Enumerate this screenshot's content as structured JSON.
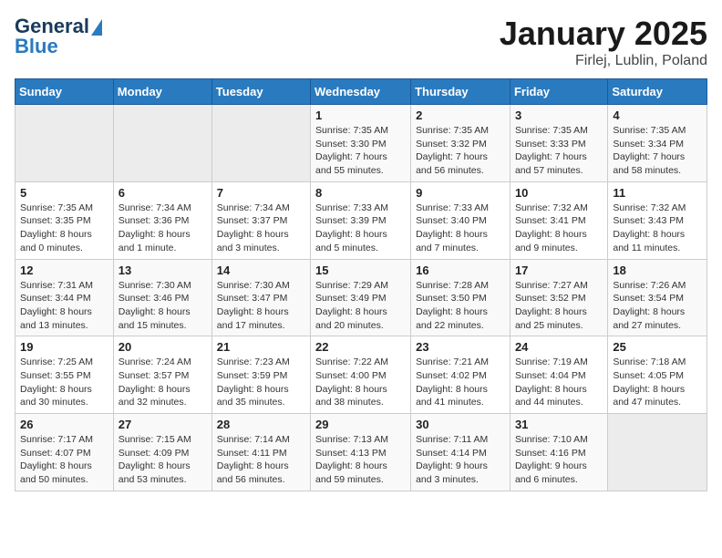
{
  "header": {
    "logo_line1": "General",
    "logo_line2": "Blue",
    "title": "January 2025",
    "subtitle": "Firlej, Lublin, Poland"
  },
  "weekdays": [
    "Sunday",
    "Monday",
    "Tuesday",
    "Wednesday",
    "Thursday",
    "Friday",
    "Saturday"
  ],
  "weeks": [
    [
      {
        "day": "",
        "sunrise": "",
        "sunset": "",
        "daylight": ""
      },
      {
        "day": "",
        "sunrise": "",
        "sunset": "",
        "daylight": ""
      },
      {
        "day": "",
        "sunrise": "",
        "sunset": "",
        "daylight": ""
      },
      {
        "day": "1",
        "sunrise": "Sunrise: 7:35 AM",
        "sunset": "Sunset: 3:30 PM",
        "daylight": "Daylight: 7 hours and 55 minutes."
      },
      {
        "day": "2",
        "sunrise": "Sunrise: 7:35 AM",
        "sunset": "Sunset: 3:32 PM",
        "daylight": "Daylight: 7 hours and 56 minutes."
      },
      {
        "day": "3",
        "sunrise": "Sunrise: 7:35 AM",
        "sunset": "Sunset: 3:33 PM",
        "daylight": "Daylight: 7 hours and 57 minutes."
      },
      {
        "day": "4",
        "sunrise": "Sunrise: 7:35 AM",
        "sunset": "Sunset: 3:34 PM",
        "daylight": "Daylight: 7 hours and 58 minutes."
      }
    ],
    [
      {
        "day": "5",
        "sunrise": "Sunrise: 7:35 AM",
        "sunset": "Sunset: 3:35 PM",
        "daylight": "Daylight: 8 hours and 0 minutes."
      },
      {
        "day": "6",
        "sunrise": "Sunrise: 7:34 AM",
        "sunset": "Sunset: 3:36 PM",
        "daylight": "Daylight: 8 hours and 1 minute."
      },
      {
        "day": "7",
        "sunrise": "Sunrise: 7:34 AM",
        "sunset": "Sunset: 3:37 PM",
        "daylight": "Daylight: 8 hours and 3 minutes."
      },
      {
        "day": "8",
        "sunrise": "Sunrise: 7:33 AM",
        "sunset": "Sunset: 3:39 PM",
        "daylight": "Daylight: 8 hours and 5 minutes."
      },
      {
        "day": "9",
        "sunrise": "Sunrise: 7:33 AM",
        "sunset": "Sunset: 3:40 PM",
        "daylight": "Daylight: 8 hours and 7 minutes."
      },
      {
        "day": "10",
        "sunrise": "Sunrise: 7:32 AM",
        "sunset": "Sunset: 3:41 PM",
        "daylight": "Daylight: 8 hours and 9 minutes."
      },
      {
        "day": "11",
        "sunrise": "Sunrise: 7:32 AM",
        "sunset": "Sunset: 3:43 PM",
        "daylight": "Daylight: 8 hours and 11 minutes."
      }
    ],
    [
      {
        "day": "12",
        "sunrise": "Sunrise: 7:31 AM",
        "sunset": "Sunset: 3:44 PM",
        "daylight": "Daylight: 8 hours and 13 minutes."
      },
      {
        "day": "13",
        "sunrise": "Sunrise: 7:30 AM",
        "sunset": "Sunset: 3:46 PM",
        "daylight": "Daylight: 8 hours and 15 minutes."
      },
      {
        "day": "14",
        "sunrise": "Sunrise: 7:30 AM",
        "sunset": "Sunset: 3:47 PM",
        "daylight": "Daylight: 8 hours and 17 minutes."
      },
      {
        "day": "15",
        "sunrise": "Sunrise: 7:29 AM",
        "sunset": "Sunset: 3:49 PM",
        "daylight": "Daylight: 8 hours and 20 minutes."
      },
      {
        "day": "16",
        "sunrise": "Sunrise: 7:28 AM",
        "sunset": "Sunset: 3:50 PM",
        "daylight": "Daylight: 8 hours and 22 minutes."
      },
      {
        "day": "17",
        "sunrise": "Sunrise: 7:27 AM",
        "sunset": "Sunset: 3:52 PM",
        "daylight": "Daylight: 8 hours and 25 minutes."
      },
      {
        "day": "18",
        "sunrise": "Sunrise: 7:26 AM",
        "sunset": "Sunset: 3:54 PM",
        "daylight": "Daylight: 8 hours and 27 minutes."
      }
    ],
    [
      {
        "day": "19",
        "sunrise": "Sunrise: 7:25 AM",
        "sunset": "Sunset: 3:55 PM",
        "daylight": "Daylight: 8 hours and 30 minutes."
      },
      {
        "day": "20",
        "sunrise": "Sunrise: 7:24 AM",
        "sunset": "Sunset: 3:57 PM",
        "daylight": "Daylight: 8 hours and 32 minutes."
      },
      {
        "day": "21",
        "sunrise": "Sunrise: 7:23 AM",
        "sunset": "Sunset: 3:59 PM",
        "daylight": "Daylight: 8 hours and 35 minutes."
      },
      {
        "day": "22",
        "sunrise": "Sunrise: 7:22 AM",
        "sunset": "Sunset: 4:00 PM",
        "daylight": "Daylight: 8 hours and 38 minutes."
      },
      {
        "day": "23",
        "sunrise": "Sunrise: 7:21 AM",
        "sunset": "Sunset: 4:02 PM",
        "daylight": "Daylight: 8 hours and 41 minutes."
      },
      {
        "day": "24",
        "sunrise": "Sunrise: 7:19 AM",
        "sunset": "Sunset: 4:04 PM",
        "daylight": "Daylight: 8 hours and 44 minutes."
      },
      {
        "day": "25",
        "sunrise": "Sunrise: 7:18 AM",
        "sunset": "Sunset: 4:05 PM",
        "daylight": "Daylight: 8 hours and 47 minutes."
      }
    ],
    [
      {
        "day": "26",
        "sunrise": "Sunrise: 7:17 AM",
        "sunset": "Sunset: 4:07 PM",
        "daylight": "Daylight: 8 hours and 50 minutes."
      },
      {
        "day": "27",
        "sunrise": "Sunrise: 7:15 AM",
        "sunset": "Sunset: 4:09 PM",
        "daylight": "Daylight: 8 hours and 53 minutes."
      },
      {
        "day": "28",
        "sunrise": "Sunrise: 7:14 AM",
        "sunset": "Sunset: 4:11 PM",
        "daylight": "Daylight: 8 hours and 56 minutes."
      },
      {
        "day": "29",
        "sunrise": "Sunrise: 7:13 AM",
        "sunset": "Sunset: 4:13 PM",
        "daylight": "Daylight: 8 hours and 59 minutes."
      },
      {
        "day": "30",
        "sunrise": "Sunrise: 7:11 AM",
        "sunset": "Sunset: 4:14 PM",
        "daylight": "Daylight: 9 hours and 3 minutes."
      },
      {
        "day": "31",
        "sunrise": "Sunrise: 7:10 AM",
        "sunset": "Sunset: 4:16 PM",
        "daylight": "Daylight: 9 hours and 6 minutes."
      },
      {
        "day": "",
        "sunrise": "",
        "sunset": "",
        "daylight": ""
      }
    ]
  ]
}
